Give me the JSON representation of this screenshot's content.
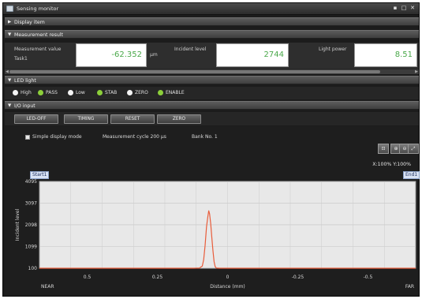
{
  "window": {
    "title": "Sensing monitor",
    "controls": [
      "▪",
      "□",
      "✕"
    ]
  },
  "sections": {
    "display_item": "Display item",
    "measurement_result": "Measurement result",
    "led_light": "LED light",
    "io_input": "I/O input"
  },
  "measurement": {
    "value_label": "Measurement value",
    "task_label": "Task1",
    "value": "-62.352",
    "value_unit": "μm",
    "incident_label": "Incident level",
    "incident_value": "2744",
    "light_label": "Light power",
    "light_value": "8.51"
  },
  "leds": [
    {
      "label": "High",
      "color": "#f4f4f4"
    },
    {
      "label": "PASS",
      "color": "#8ccf3a"
    },
    {
      "label": "Low",
      "color": "#f4f4f4"
    },
    {
      "label": "STAB",
      "color": "#8ccf3a"
    },
    {
      "label": "ZERO",
      "color": "#f4f4f4"
    },
    {
      "label": "ENABLE",
      "color": "#8ccf3a"
    }
  ],
  "io_buttons": [
    "LED-OFF",
    "TIMING",
    "RESET",
    "ZERO"
  ],
  "options": {
    "simple_mode": "Simple display mode",
    "cycle": "Measurement cycle 200 μs",
    "bank": "Bank No.  1"
  },
  "toolbar": {
    "zoom_text": "X:100% Y:100%",
    "tools": [
      "fit-icon",
      "zoom-in-icon",
      "zoom-out-icon",
      "expand-icon"
    ]
  },
  "markers": {
    "start": "Start1",
    "end": "End1"
  },
  "chart_data": {
    "type": "line",
    "ylabel": "Incident level",
    "xlabel": "Distance (mm)",
    "y_ticks": [
      "4095",
      "3097",
      "2098",
      "1099",
      "100"
    ],
    "y_tick_values": [
      4095,
      3097,
      2098,
      1099,
      100
    ],
    "x_ticks": [
      "0.5",
      "0.25",
      "0",
      "-0.25",
      "-0.5"
    ],
    "x_tick_values": [
      0.5,
      0.25,
      0,
      -0.25,
      -0.5
    ],
    "x_left_label": "NEAR",
    "x_right_label": "FAR",
    "xlim": [
      0.67,
      -0.67
    ],
    "ylim": [
      100,
      4095
    ],
    "grid": true,
    "line_color": "#e85c3a",
    "plot_bg": "#e8e8e8",
    "series": [
      {
        "x": [
          0.67,
          0.2,
          0.12,
          0.1,
          0.09,
          0.085,
          0.08,
          0.075,
          0.07,
          0.067,
          0.064,
          0.06,
          0.056,
          0.052,
          0.048,
          0.044,
          0.04,
          0.03,
          0.0,
          -0.3,
          -0.67
        ],
        "y": [
          100,
          100,
          100,
          110,
          200,
          500,
          1150,
          2000,
          2500,
          2744,
          2600,
          2150,
          1500,
          900,
          400,
          170,
          110,
          100,
          100,
          100,
          100
        ]
      }
    ]
  }
}
